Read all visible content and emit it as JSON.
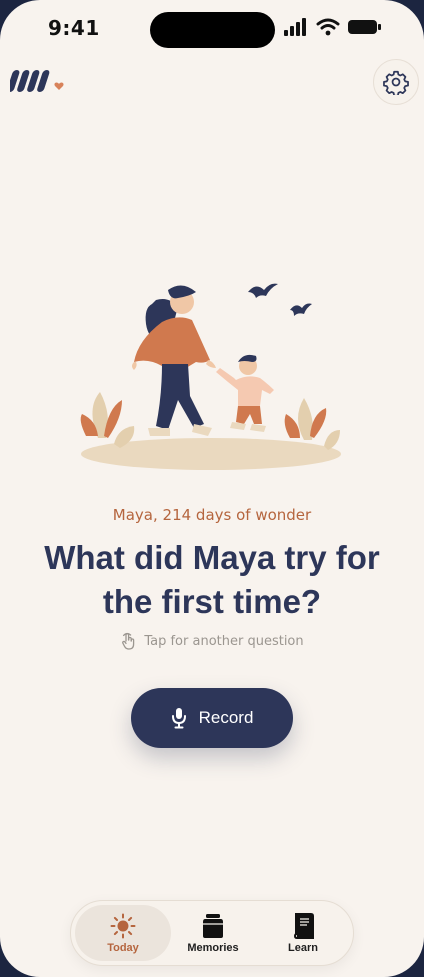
{
  "status_bar": {
    "time": "9:41"
  },
  "header": {
    "logo_icon": "app-logo",
    "settings_icon": "gear-icon"
  },
  "prompt": {
    "subtitle": "Maya, 214 days of wonder",
    "question": "What did Maya try for the first time?",
    "hint": "Tap for another question",
    "hint_icon": "tap-hand-icon"
  },
  "record_button": {
    "label": "Record",
    "icon": "microphone-icon"
  },
  "tabs": [
    {
      "label": "Today",
      "icon": "sun-icon",
      "active": true
    },
    {
      "label": "Memories",
      "icon": "jar-icon",
      "active": false
    },
    {
      "label": "Learn",
      "icon": "book-icon",
      "active": false
    }
  ],
  "colors": {
    "background": "#f8f3ee",
    "navy": "#2d3659",
    "accent": "#b5653e"
  }
}
